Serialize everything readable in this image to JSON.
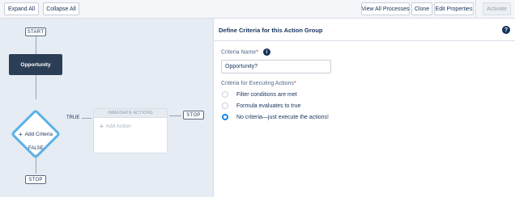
{
  "toolbar": {
    "expand_all": "Expand All",
    "collapse_all": "Collapse All",
    "view_all_processes": "View All Processes",
    "clone": "Clone",
    "edit_properties": "Edit Properties",
    "activate": "Activate"
  },
  "canvas": {
    "start": "START",
    "object_node": "Opportunity",
    "criteria_node": "Add Criteria",
    "true_label": "TRUE",
    "false_label": "FALSE",
    "immediate_actions_header": "IMMEDIATE ACTIONS",
    "add_action": "Add Action",
    "stop_right": "STOP",
    "stop_bottom": "STOP",
    "icons": {
      "add": "plus-icon"
    }
  },
  "panel": {
    "title": "Define Criteria for this Action Group",
    "help_icon": "question-circle-icon",
    "criteria_name_label": "Criteria Name",
    "required_marker": "*",
    "info_icon": "info-icon",
    "criteria_name_value": "Opportunity?",
    "criteria_for_label": "Criteria for Executing Actions",
    "options": [
      {
        "label": "Filter conditions are met",
        "selected": false
      },
      {
        "label": "Formula evaluates to true",
        "selected": false
      },
      {
        "label": "No criteria—just execute the actions!",
        "selected": true
      }
    ]
  },
  "colors": {
    "canvas_bg": "#e6ecf3",
    "object_node_bg": "#2c3e56",
    "diamond_border": "#5bb2e6",
    "radio_selected": "#1589ee",
    "required": "#c23934"
  }
}
